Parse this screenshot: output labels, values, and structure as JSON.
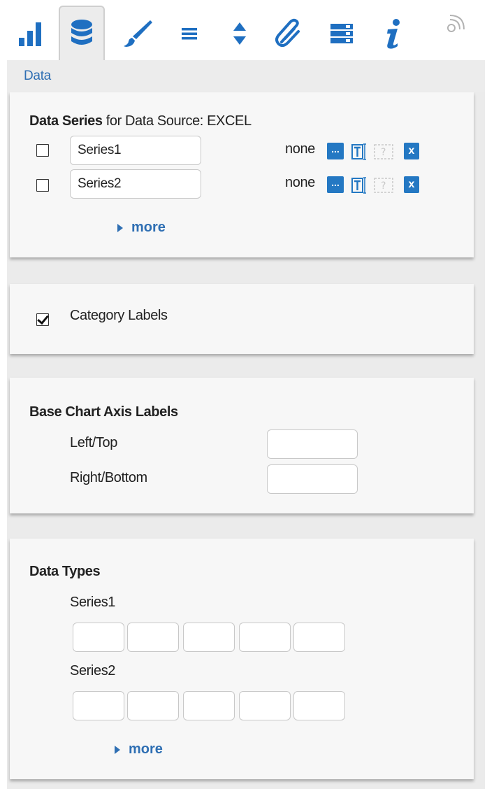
{
  "tabs": [
    {
      "icon": "bar-chart-icon",
      "active": false
    },
    {
      "icon": "database-icon",
      "active": true
    },
    {
      "icon": "brush-icon",
      "active": false
    },
    {
      "icon": "menu-lines-icon",
      "active": false
    },
    {
      "icon": "sort-arrows-icon",
      "active": false
    },
    {
      "icon": "paperclip-icon",
      "active": false
    },
    {
      "icon": "server-rows-icon",
      "active": false
    },
    {
      "icon": "info-icon",
      "active": false
    }
  ],
  "section_label": "Data",
  "data_series": {
    "title_bold": "Data Series",
    "title_rest": " for Data Source: EXCEL",
    "rows": [
      {
        "name": "Series1",
        "checked": false,
        "mapping": "none",
        "dots_label": "...",
        "remove_label": "x"
      },
      {
        "name": "Series2",
        "checked": false,
        "mapping": "none",
        "dots_label": "...",
        "remove_label": "x"
      }
    ],
    "more_label": "more"
  },
  "category": {
    "label": "Category Labels",
    "checked": true
  },
  "axis_labels": {
    "title": "Base Chart Axis Labels",
    "left_top_label": "Left/Top",
    "left_top_value": "",
    "right_bottom_label": "Right/Bottom",
    "right_bottom_value": ""
  },
  "data_types": {
    "title": "Data Types",
    "series": [
      {
        "name": "Series1",
        "values": [
          "",
          "",
          "",
          "",
          ""
        ]
      },
      {
        "name": "Series2",
        "values": [
          "",
          "",
          "",
          "",
          ""
        ]
      }
    ],
    "more_label": "more"
  },
  "colors": {
    "accent": "#2478c3",
    "link": "#2f6fb3",
    "panel": "#f7f7f7",
    "background": "#ebebeb"
  }
}
